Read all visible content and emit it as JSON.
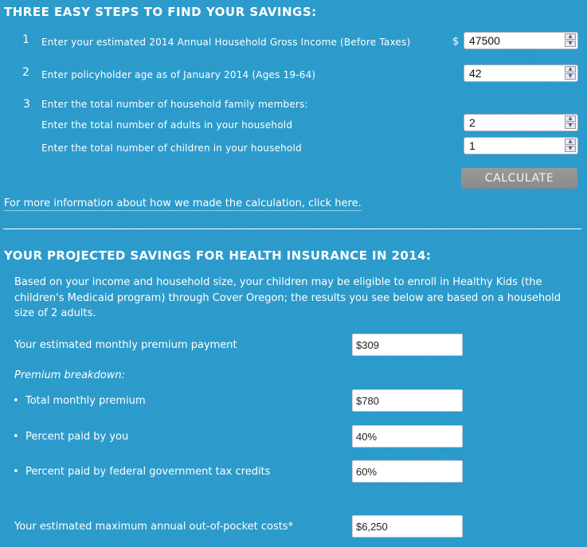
{
  "steps_section": {
    "title": "THREE EASY STEPS TO FIND YOUR SAVINGS:",
    "step1": {
      "number": "1",
      "label": "Enter your estimated 2014 Annual Household Gross Income (Before Taxes)",
      "currency": "$",
      "value": "47500"
    },
    "step2": {
      "number": "2",
      "label": "Enter policyholder age as of January 2014 (Ages 19-64)",
      "value": "42"
    },
    "step3": {
      "number": "3",
      "label": "Enter the total number of household family members:",
      "adults_label": "Enter the total number of adults in your household",
      "adults_value": "2",
      "children_label": "Enter the total number of children in your household",
      "children_value": "1"
    },
    "calculate_label": "CALCULATE",
    "info_link": "For more information about how we made the calculation, click here."
  },
  "results_section": {
    "title": "YOUR PROJECTED SAVINGS FOR HEALTH INSURANCE IN 2014:",
    "note": "Based on your income and household size, your children may be eligible to enroll in Healthy Kids (the children's Medicaid program) through Cover Oregon; the results you see below are based on a household size of 2 adults.",
    "monthly_premium_label": "Your estimated monthly premium payment",
    "monthly_premium_value": "$309",
    "breakdown_label": "Premium breakdown:",
    "breakdown": [
      {
        "label": "Total monthly premium",
        "value": "$780"
      },
      {
        "label": "Percent paid by you",
        "value": "40%"
      },
      {
        "label": "Percent paid by federal government tax credits",
        "value": "60%"
      }
    ],
    "oop_label": "Your estimated maximum annual out-of-pocket costs*",
    "oop_value": "$6,250"
  },
  "icons": {
    "spin_up": "▲",
    "spin_down": "▼",
    "bullet": "•"
  }
}
